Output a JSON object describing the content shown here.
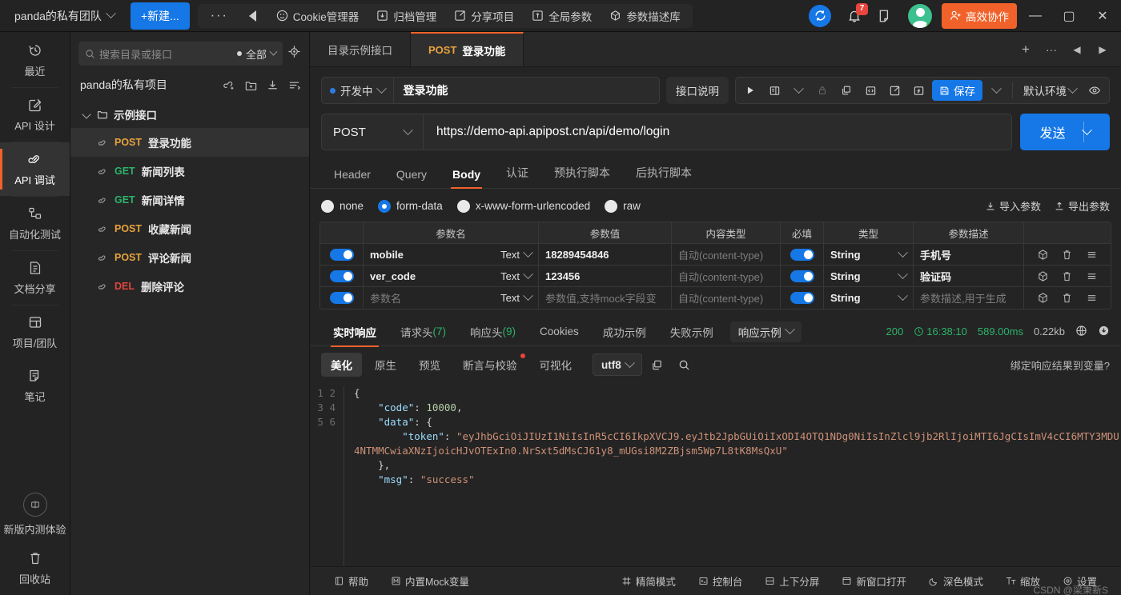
{
  "topbar": {
    "team_name": "panda的私有团队",
    "new_button": "+新建...",
    "more_label": "···",
    "menu": [
      {
        "label": "Cookie管理器",
        "icon": "cookie-icon"
      },
      {
        "label": "归档管理",
        "icon": "archive-icon"
      },
      {
        "label": "分享项目",
        "icon": "share-icon"
      },
      {
        "label": "全局参数",
        "icon": "global-param-icon"
      },
      {
        "label": "参数描述库",
        "icon": "param-lib-icon"
      }
    ],
    "notification_count": "7",
    "collab_label": "高效协作",
    "window_minimize": "—",
    "window_maximize": "▢",
    "window_close": "✕"
  },
  "rail": {
    "items": [
      {
        "label": "最近",
        "icon": "history-icon",
        "active": false
      },
      {
        "label": "API 设计",
        "icon": "design-icon",
        "active": false
      },
      {
        "label": "API 调试",
        "icon": "debug-icon",
        "active": true
      },
      {
        "label": "自动化测试",
        "icon": "automation-icon",
        "active": false
      },
      {
        "label": "文档分享",
        "icon": "doc-share-icon",
        "active": false
      },
      {
        "label": "项目/团队",
        "icon": "project-team-icon",
        "active": false
      },
      {
        "label": "笔记",
        "icon": "notes-icon",
        "active": false
      }
    ],
    "beta_label": "新版内测体验",
    "recycle_label": "回收站"
  },
  "tree": {
    "search_placeholder": "搜索目录或接口",
    "scope_label": "全部",
    "locate_icon": "crosshair-icon",
    "project_name": "panda的私有项目",
    "project_actions": [
      "add-api-icon",
      "add-folder-icon",
      "import-icon",
      "sort-icon"
    ],
    "folder": "示例接口",
    "apis": [
      {
        "method": "POST",
        "name": "登录功能",
        "active": true
      },
      {
        "method": "GET",
        "name": "新闻列表",
        "active": false
      },
      {
        "method": "GET",
        "name": "新闻详情",
        "active": false
      },
      {
        "method": "POST",
        "name": "收藏新闻",
        "active": false
      },
      {
        "method": "POST",
        "name": "评论新闻",
        "active": false
      },
      {
        "method": "DEL",
        "name": "删除评论",
        "active": false
      }
    ]
  },
  "doc_tabs": {
    "tabs": [
      {
        "label": "目录示例接口",
        "method": "",
        "active": false
      },
      {
        "label": "登录功能",
        "method": "POST",
        "active": true
      }
    ],
    "add": "+",
    "more": "···",
    "prev": "◀",
    "next": "▶"
  },
  "request": {
    "status_label": "开发中",
    "name": "登录功能",
    "doc_button": "接口说明",
    "toolbar_icons": [
      "run-icon",
      "layout-icon",
      "chevron-down-icon",
      "lock-icon",
      "copy-icon",
      "code-icon",
      "export-icon",
      "mock-icon"
    ],
    "save_label": "保存",
    "env_label": "默认环境",
    "eye_icon": "eye-icon",
    "method": "POST",
    "url": "https://demo-api.apipost.cn/api/demo/login",
    "send_label": "发送",
    "tabs": [
      {
        "label": "Header",
        "active": false
      },
      {
        "label": "Query",
        "active": false
      },
      {
        "label": "Body",
        "active": true
      },
      {
        "label": "认证",
        "active": false
      },
      {
        "label": "预执行脚本",
        "active": false
      },
      {
        "label": "后执行脚本",
        "active": false
      }
    ],
    "body_types": [
      {
        "label": "none",
        "selected": false
      },
      {
        "label": "form-data",
        "selected": true
      },
      {
        "label": "x-www-form-urlencoded",
        "selected": false
      },
      {
        "label": "raw",
        "selected": false
      }
    ],
    "import_label": "导入参数",
    "export_label": "导出参数"
  },
  "param_table": {
    "columns": [
      "",
      "参数名",
      "参数值",
      "内容类型",
      "必填",
      "类型",
      "参数描述",
      ""
    ],
    "rows": [
      {
        "enabled": true,
        "name": "mobile",
        "name_placeholder": "",
        "text_type": "Text",
        "value": "18289454846",
        "value_placeholder": "",
        "content_type": "自动(content-type)",
        "required": true,
        "type": "String",
        "desc": "手机号",
        "desc_placeholder": ""
      },
      {
        "enabled": true,
        "name": "ver_code",
        "name_placeholder": "",
        "text_type": "Text",
        "value": "123456",
        "value_placeholder": "",
        "content_type": "自动(content-type)",
        "required": true,
        "type": "String",
        "desc": "验证码",
        "desc_placeholder": ""
      },
      {
        "enabled": true,
        "name": "",
        "name_placeholder": "参数名",
        "text_type": "Text",
        "value": "",
        "value_placeholder": "参数值,支持mock字段变",
        "content_type": "自动(content-type)",
        "required": true,
        "type": "String",
        "desc": "",
        "desc_placeholder": "参数描述,用于生成"
      }
    ],
    "row_actions": [
      "box-icon",
      "delete-icon",
      "drag-icon"
    ]
  },
  "response": {
    "tabs": [
      {
        "label": "实时响应",
        "count": "",
        "active": true
      },
      {
        "label": "请求头",
        "count": "(7)",
        "active": false
      },
      {
        "label": "响应头",
        "count": "(9)",
        "active": false
      },
      {
        "label": "Cookies",
        "count": "",
        "active": false
      },
      {
        "label": "成功示例",
        "count": "",
        "active": false
      },
      {
        "label": "失败示例",
        "count": "",
        "active": false
      }
    ],
    "example_select": "响应示例",
    "status_code": "200",
    "time": "16:38:10",
    "duration": "589.00ms",
    "size": "0.22kb",
    "globe_icon": "globe-icon",
    "download_icon": "download-icon",
    "formats": [
      {
        "label": "美化",
        "active": true,
        "dot": false
      },
      {
        "label": "原生",
        "active": false,
        "dot": false
      },
      {
        "label": "预览",
        "active": false,
        "dot": false
      },
      {
        "label": "断言与校验",
        "active": false,
        "dot": true
      },
      {
        "label": "可视化",
        "active": false,
        "dot": false
      }
    ],
    "encoding": "utf8",
    "copy_icon": "copy-icon",
    "search_icon": "search-icon",
    "bind_var_label": "绑定响应结果到变量?",
    "line_numbers": [
      "1",
      "2",
      "3",
      "4",
      "5",
      "6"
    ],
    "json": {
      "code_key": "\"code\"",
      "code_value": "10000",
      "data_key": "\"data\"",
      "token_key": "\"token\"",
      "token_value": "\"eyJhbGciOiJIUzI1NiIsInR5cCI6IkpXVCJ9.eyJtb2JpbGUiOiIxODI4OTQ1NDg0NiIsInZlcl9jb2RlIjoiMTI6JgCIsImV4cCI6MTY3MDU4NTMMCwiaXNzIjoicHJvOTExIn0.NrSxt5dMsCJ61y8_mUGsi8M2ZBjsm5Wp7L8tK8MsQxU\"",
      "msg_key": "\"msg\"",
      "msg_value": "\"success\""
    }
  },
  "statusbar": {
    "items": [
      {
        "label": "帮助",
        "icon": "help-icon"
      },
      {
        "label": "内置Mock变量",
        "icon": "mock-var-icon"
      },
      {
        "label": "精简模式",
        "icon": "compact-icon"
      },
      {
        "label": "控制台",
        "icon": "console-icon"
      },
      {
        "label": "上下分屏",
        "icon": "split-icon"
      },
      {
        "label": "新窗口打开",
        "icon": "new-window-icon"
      },
      {
        "label": "深色模式",
        "icon": "dark-mode-icon"
      },
      {
        "label": "缩放",
        "icon": "zoom-icon"
      },
      {
        "label": "设置",
        "icon": "settings-icon"
      }
    ],
    "watermark": "CSDN @梁秉新S"
  },
  "colors": {
    "accent_blue": "#1677e6",
    "accent_orange": "#f0622a",
    "method_post": "#e8a33d",
    "method_get": "#2cb36a",
    "method_del": "#e0453c",
    "success_green": "#2cb36a"
  }
}
